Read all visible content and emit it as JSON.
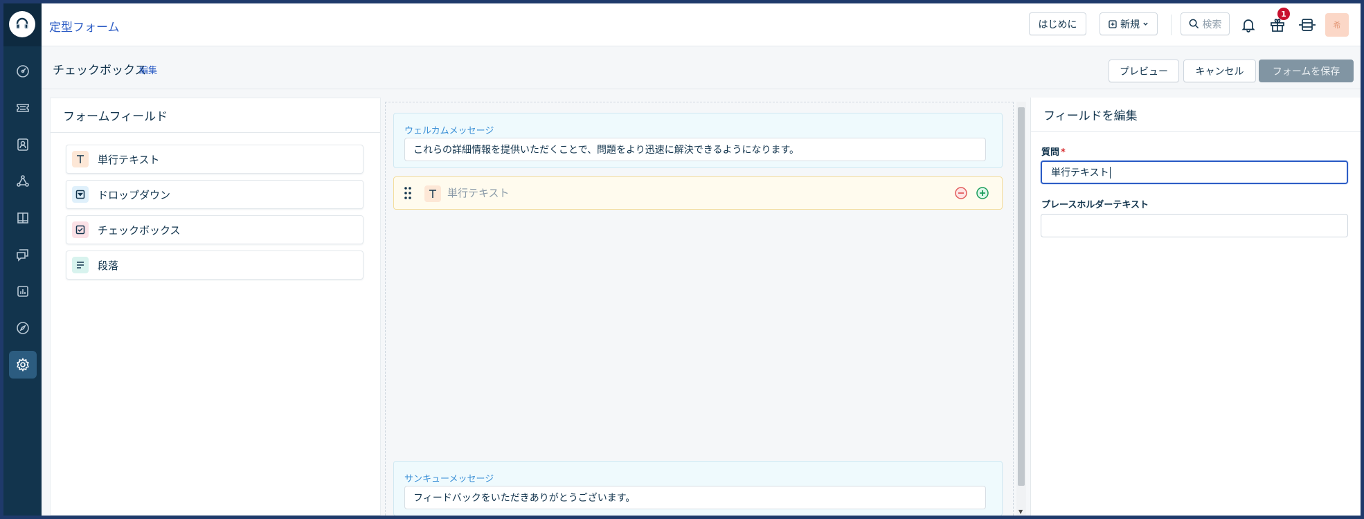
{
  "colors": {
    "rail": "#12344d",
    "accent": "#2c5cc5",
    "save_disabled": "#8195a3",
    "message_bg": "#effafd",
    "active_field_bg": "#fffbee",
    "badge": "#c8102e"
  },
  "header": {
    "title": "定型フォーム",
    "getting_started": "はじめに",
    "new_label": "新規",
    "search_placeholder": "検索",
    "notification_count": "1",
    "avatar_initial": "希"
  },
  "rail": {
    "icons": [
      "dashboard-icon",
      "tickets-icon",
      "contacts-icon",
      "workflow-icon",
      "knowledge-base-icon",
      "forums-icon",
      "reports-icon",
      "discover-icon",
      "settings-icon"
    ],
    "active": "settings-icon"
  },
  "subheader": {
    "page_title": "チェックボックス",
    "edit_link": "編集",
    "preview": "プレビュー",
    "cancel": "キャンセル",
    "save": "フォームを保存"
  },
  "form_fields": {
    "heading": "フォームフィールド",
    "items": [
      {
        "label": "単行テキスト",
        "icon": "text-icon"
      },
      {
        "label": "ドロップダウン",
        "icon": "dropdown-icon"
      },
      {
        "label": "チェックボックス",
        "icon": "checkbox-icon"
      },
      {
        "label": "段落",
        "icon": "paragraph-icon"
      }
    ]
  },
  "canvas": {
    "welcome_label": "ウェルカムメッセージ",
    "welcome_value": "これらの詳細情報を提供いただくことで、問題をより迅速に解決できるようになります。",
    "active_field_label": "単行テキスト",
    "thanks_label": "サンキューメッセージ",
    "thanks_value": "フィードバックをいただきありがとうございます。"
  },
  "edit_field": {
    "heading": "フィールドを編集",
    "question_label": "質問",
    "required_mark": "*",
    "question_value": "単行テキスト",
    "placeholder_label": "プレースホルダーテキスト",
    "placeholder_value": ""
  }
}
